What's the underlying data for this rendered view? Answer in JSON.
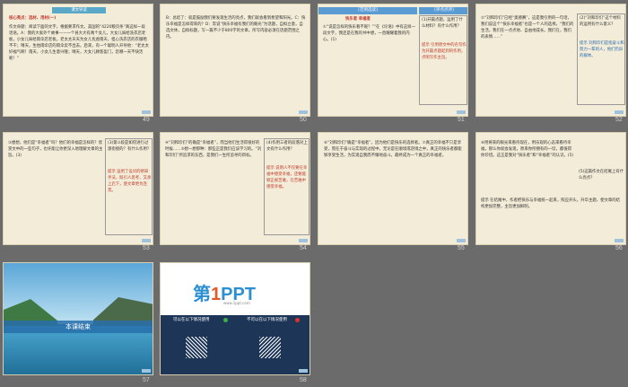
{
  "slides": [
    {
      "num": "49",
      "bar": "课文导读",
      "title": "核心亮点：选材、用材(一)",
      "body": "作文命题：阅读下面的文字，根据要求作文。美国的“4220粮页条”真这样一段话语。A：我的大家外个故事——一个县大大有两个女儿，大女儿嫁给洗衣店老板，小女儿嫁给雨伞店老板。老太太天天为女儿忧虑雨天，担心洗衣店的衣服晒不干；晴天，生怕雨伞店的雨伞卖不出去。后来，有一个聪明人开导他：“老太太好福气啊！雨天，小女儿生意兴隆；晴天，大女儿顾客盈门，您哪一天不快活呢！”"
    },
    {
      "num": "50",
      "body": "B：总结了：就是鼓励我们要发现生活的亮点，我们就会看到希望和阳光。C：快乐幸福是怎样得来的？D：常说“快乐幸福有我们的眼光”为话题，自拟立意，自选文体，自拟标题，写一篇不少于800字的文章。所写内容必须在话题范围之内。"
    },
    {
      "num": "51",
      "tab": "[范例选读]",
      "tab2": "[评点点评]",
      "title": "快乐者 幸福者",
      "body": "①“说是怎样的快乐看不呢？”“在《论语》中有这样一段文字，我还是在我的书中想，一直耀耀着我的内心。(1)",
      "side": "(1)开篇点题，运用了什么材料？有什么作用？",
      "tip": "提示 引用原文中的名句作为开篇点题起到的作用，点明写作主旨。"
    },
    {
      "num": "52",
      "body": "②“刘和珍们”已经“奥德赛”，这是我引用的一句话，我们说这个“快乐幸福者”也是一个人的选择。“我们的生活，我们在一点点地、自由地成长。我们在，我们的表情……”",
      "side": "(2)“刘和珍们”这个材料的运用有什么意义？",
      "tip": "提示 刘和珍们是指奋斗和努力一辈的人，他们仍旧的群体。"
    },
    {
      "num": "53",
      "body": "③想想，他们是“幸福者”吗？他们的幸福是怎样的？欣赏文中的一些句子，也许能让你更深入地理解文章的主旨。(3)",
      "side": "(3)第③段是如何进行过渡衔接的？有什么作用？",
      "tip": "提示 运用了设问的修辞手法，既引人思考，又承上启下，使文章更为连贯。"
    },
    {
      "num": "54",
      "body": "④“刘和珍们”的确是“幸福者”，而当他们生活得很好的时候……⑤想一想那种：那些正是我们应该学习的。“刘和珍们”所追求的东西，是我们一生所追寻的目标。",
      "side": "(4)作用三者的段落对上文有什么作用？",
      "tip": "提示 说明人不仅要在幸福中感受幸福，还要能够正视苦难，在苦难中感受幸福。"
    },
    {
      "num": "55",
      "body": "⑥“刘和珍们”确是“幸福者”，因为他们是快乐的选择者。⑦真正的幸福不只是享受，而在于奋斗与实现的过程中。无论是在顺境或逆境之中，真正的快乐者都能够享受生活，为实现自我而不懈地奋斗，最终成为一个真正的幸福者。"
    },
    {
      "num": "56",
      "body": "⑧用将来的眼光来看待现在，用乐观的心态来看待幸福，那么你就会发现，原来你所拥有的一切，都值得你珍惜。这正是我对“快乐者”和“幸福者”的认识。(5)",
      "side": "(5)这篇作文在结尾上有什么亮点？",
      "tip": "提示 在结尾中，作者把快乐与幸福统一起来，照应开头，升华主题，使文章的结构更加完整，主旨更加鲜明。"
    },
    {
      "num": "57",
      "end": "本课结束"
    },
    {
      "num": "58",
      "logo_a": "第",
      "logo_b": "1",
      "logo_c": "PPT",
      "sub": "www.1ppt.com",
      "ok": "可以在以下情况使用",
      "no": "不可以在以下情况使用"
    }
  ]
}
